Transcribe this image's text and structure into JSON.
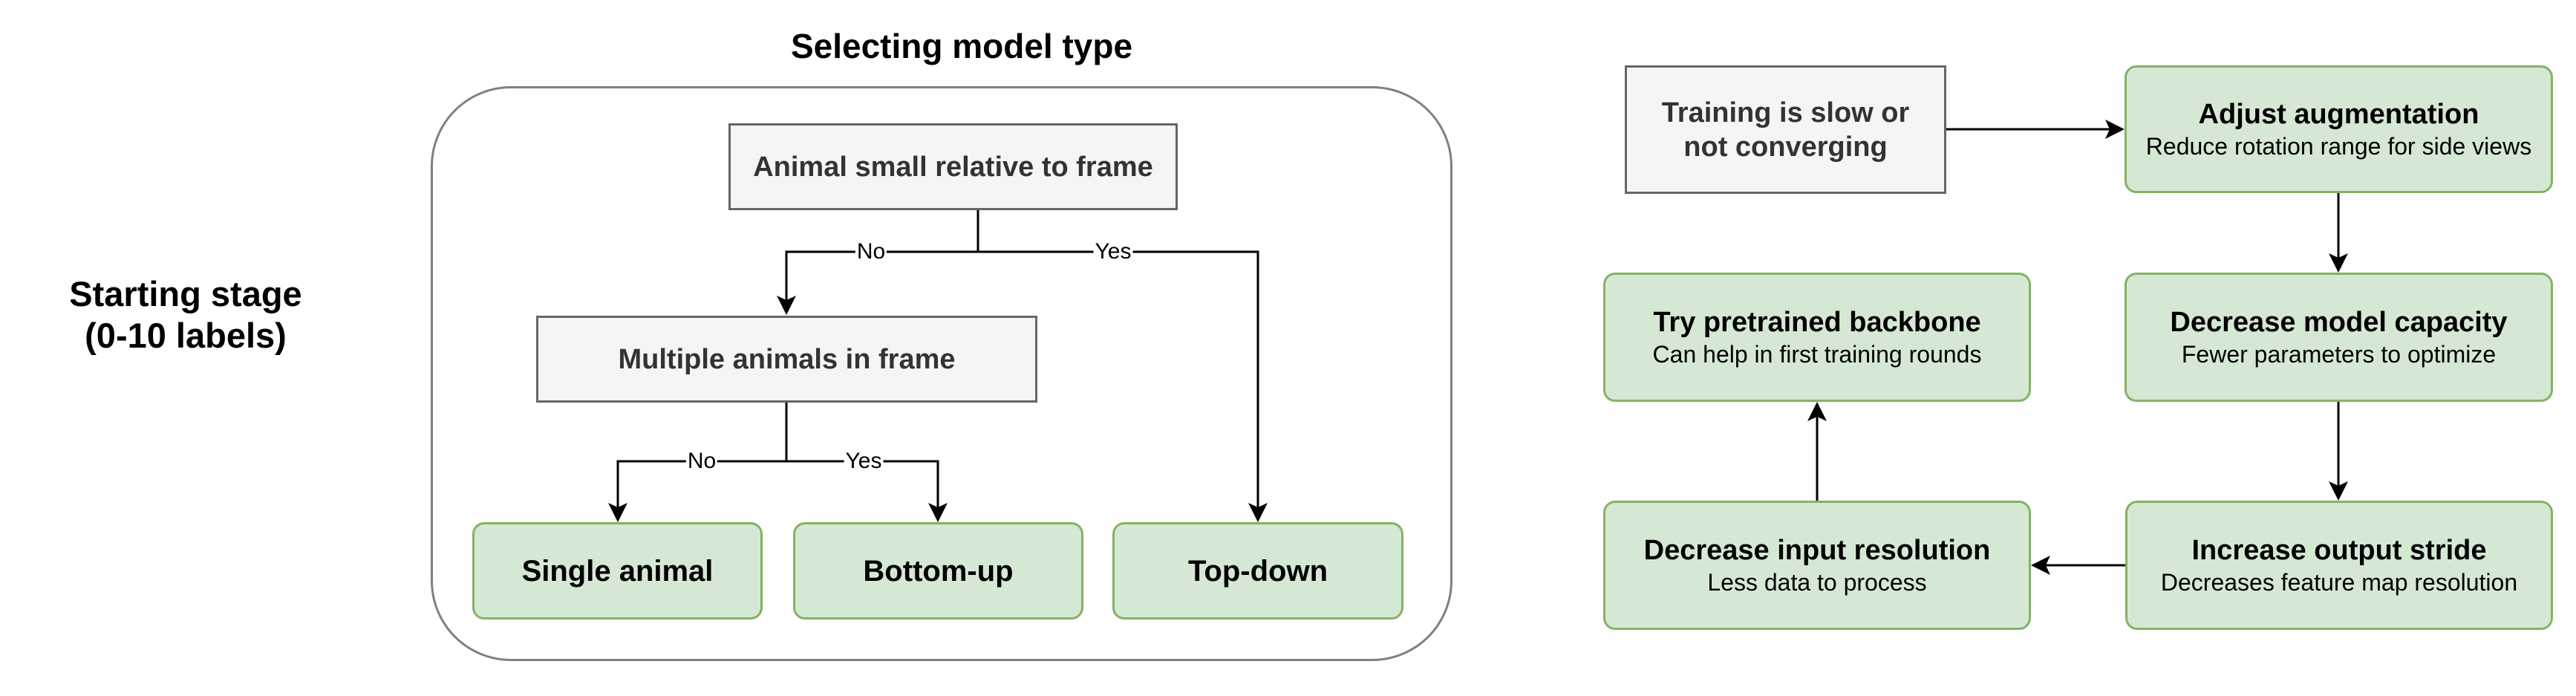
{
  "stage": {
    "line1": "Starting stage",
    "line2": "(0-10 labels)"
  },
  "model_selection": {
    "title": "Selecting model type",
    "decisions": [
      {
        "id": "animal_small",
        "text": "Animal small relative to frame"
      },
      {
        "id": "multiple_animals",
        "text": "Multiple animals in frame"
      }
    ],
    "outcomes": [
      {
        "id": "single_animal",
        "text": "Single animal"
      },
      {
        "id": "bottom_up",
        "text": "Bottom-up"
      },
      {
        "id": "top_down",
        "text": "Top-down"
      }
    ],
    "edges": [
      {
        "from": "animal_small",
        "to": "multiple_animals",
        "label": "No"
      },
      {
        "from": "animal_small",
        "to": "top_down",
        "label": "Yes"
      },
      {
        "from": "multiple_animals",
        "to": "single_animal",
        "label": "No"
      },
      {
        "from": "multiple_animals",
        "to": "bottom_up",
        "label": "Yes"
      }
    ]
  },
  "troubleshooting": {
    "problem": "Training is slow or not converging",
    "steps": [
      {
        "id": "adjust_aug",
        "title": "Adjust augmentation",
        "subtitle": "Reduce rotation range for side views"
      },
      {
        "id": "decrease_capacity",
        "title": "Decrease model capacity",
        "subtitle": "Fewer parameters to optimize"
      },
      {
        "id": "increase_stride",
        "title": "Increase output stride",
        "subtitle": "Decreases feature map resolution"
      },
      {
        "id": "decrease_input_res",
        "title": "Decrease input resolution",
        "subtitle": "Less data to process"
      },
      {
        "id": "pretrained_backbone",
        "title": "Try pretrained backbone",
        "subtitle": "Can help in first training rounds"
      }
    ],
    "flow": [
      "problem",
      "adjust_aug",
      "decrease_capacity",
      "increase_stride",
      "decrease_input_res",
      "pretrained_backbone"
    ]
  },
  "colors": {
    "decision_fill": "#f5f5f5",
    "decision_stroke": "#666666",
    "outcome_fill": "#d5e8d4",
    "outcome_stroke": "#82b366",
    "container_stroke": "#808080",
    "edge": "#000000"
  }
}
